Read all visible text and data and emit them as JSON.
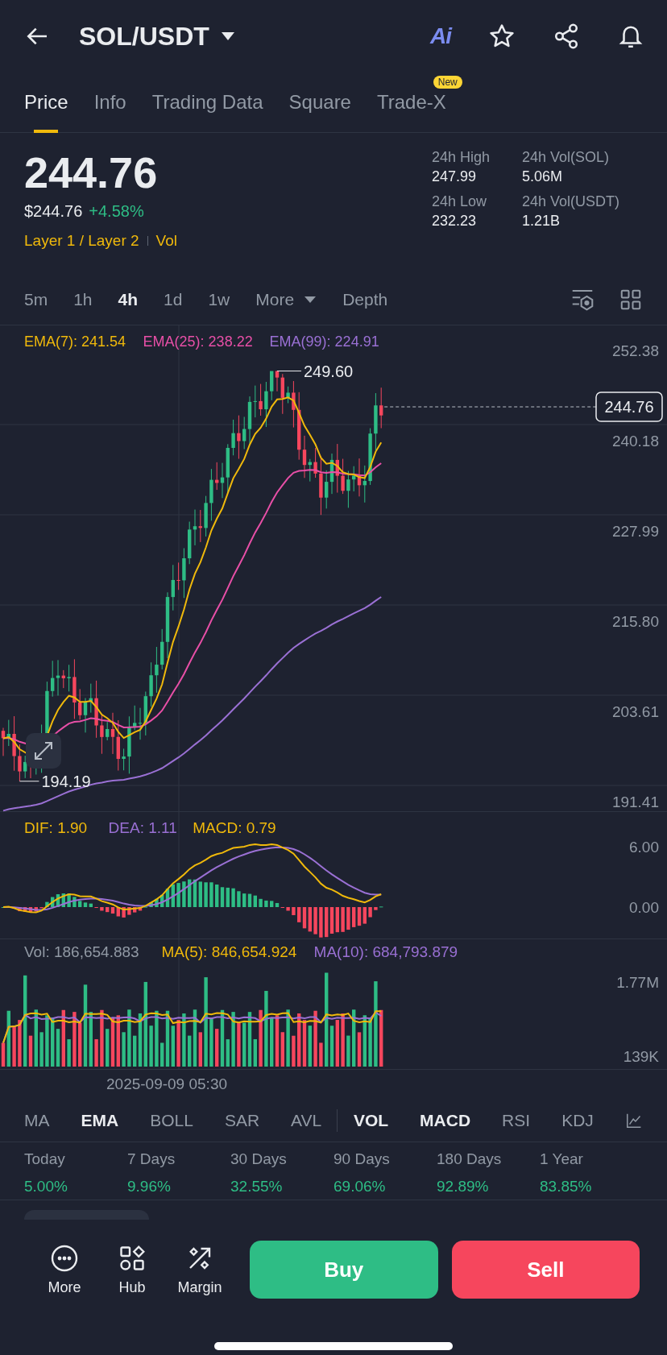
{
  "header": {
    "title": "SOL/USDT",
    "ai_badge": "Ai"
  },
  "tabs": [
    {
      "label": "Price",
      "selected": true
    },
    {
      "label": "Info",
      "selected": false
    },
    {
      "label": "Trading Data",
      "selected": false
    },
    {
      "label": "Square",
      "selected": false
    },
    {
      "label": "Trade-X",
      "selected": false,
      "badge": "New"
    }
  ],
  "price": {
    "last": "244.76",
    "fiat": "$244.76",
    "change": "+4.58%",
    "tags": [
      "Layer 1 / Layer 2",
      "Vol"
    ]
  },
  "stats": [
    {
      "label": "24h High",
      "value": "247.99"
    },
    {
      "label": "24h Vol(SOL)",
      "value": "5.06M"
    },
    {
      "label": "24h Low",
      "value": "232.23"
    },
    {
      "label": "24h Vol(USDT)",
      "value": "1.21B"
    }
  ],
  "intervals": [
    {
      "label": "5m",
      "selected": false,
      "kind": "option"
    },
    {
      "label": "1h",
      "selected": false,
      "kind": "option"
    },
    {
      "label": "4h",
      "selected": true,
      "kind": "option"
    },
    {
      "label": "1d",
      "selected": false,
      "kind": "option"
    },
    {
      "label": "1w",
      "selected": false,
      "kind": "option"
    },
    {
      "label": "More",
      "selected": false,
      "kind": "dropdown"
    },
    {
      "label": "Depth",
      "selected": false,
      "kind": "option"
    }
  ],
  "chart": {
    "legend": [
      {
        "label": "EMA(7): 241.54",
        "color": "#f0b90b"
      },
      {
        "label": "EMA(25): 238.22",
        "color": "#e84fa7"
      },
      {
        "label": "EMA(99): 224.91",
        "color": "#9a70d4"
      }
    ],
    "price_axis": [
      "252.38",
      "240.18",
      "227.99",
      "215.80",
      "203.61",
      "191.41"
    ],
    "current_price": "244.76",
    "high_marker": "249.60",
    "low_marker": "194.19"
  },
  "macd": {
    "legend": [
      {
        "label": "DIF: 1.90",
        "color": "#f0b90b"
      },
      {
        "label": "DEA: 1.11",
        "color": "#9a70d4"
      },
      {
        "label": "MACD: 0.79",
        "color": "#f0b90b"
      }
    ],
    "axis": [
      "6.00",
      "0.00"
    ]
  },
  "volume": {
    "legend": [
      {
        "label": "Vol: 186,654.883",
        "color": "#929aa5"
      },
      {
        "label": "MA(5): 846,654.924",
        "color": "#f0b90b"
      },
      {
        "label": "MA(10): 684,793.879",
        "color": "#9a70d4"
      }
    ],
    "axis": [
      "1.77M",
      "139K"
    ],
    "time_label": "2025-09-09 05:30"
  },
  "indicators": [
    {
      "label": "MA",
      "selected": false,
      "divider_before": false
    },
    {
      "label": "EMA",
      "selected": true,
      "divider_before": false
    },
    {
      "label": "BOLL",
      "selected": false,
      "divider_before": false
    },
    {
      "label": "SAR",
      "selected": false,
      "divider_before": false
    },
    {
      "label": "AVL",
      "selected": false,
      "divider_before": false
    },
    {
      "label": "VOL",
      "selected": true,
      "divider_before": true
    },
    {
      "label": "MACD",
      "selected": true,
      "divider_before": false
    },
    {
      "label": "RSI",
      "selected": false,
      "divider_before": false
    },
    {
      "label": "KDJ",
      "selected": false,
      "divider_before": false
    }
  ],
  "performance": [
    {
      "label": "Today",
      "value": "5.00%"
    },
    {
      "label": "7 Days",
      "value": "9.96%"
    },
    {
      "label": "30 Days",
      "value": "32.55%"
    },
    {
      "label": "90 Days",
      "value": "69.06%"
    },
    {
      "label": "180 Days",
      "value": "92.89%"
    },
    {
      "label": "1 Year",
      "value": "83.85%"
    }
  ],
  "actions": [
    {
      "label": "More",
      "kind": "more"
    },
    {
      "label": "Hub",
      "kind": "hub"
    },
    {
      "label": "Margin",
      "kind": "margin"
    }
  ],
  "trade_buttons": [
    {
      "label": "Buy",
      "kind": "buy"
    },
    {
      "label": "Sell",
      "kind": "sell"
    }
  ]
}
